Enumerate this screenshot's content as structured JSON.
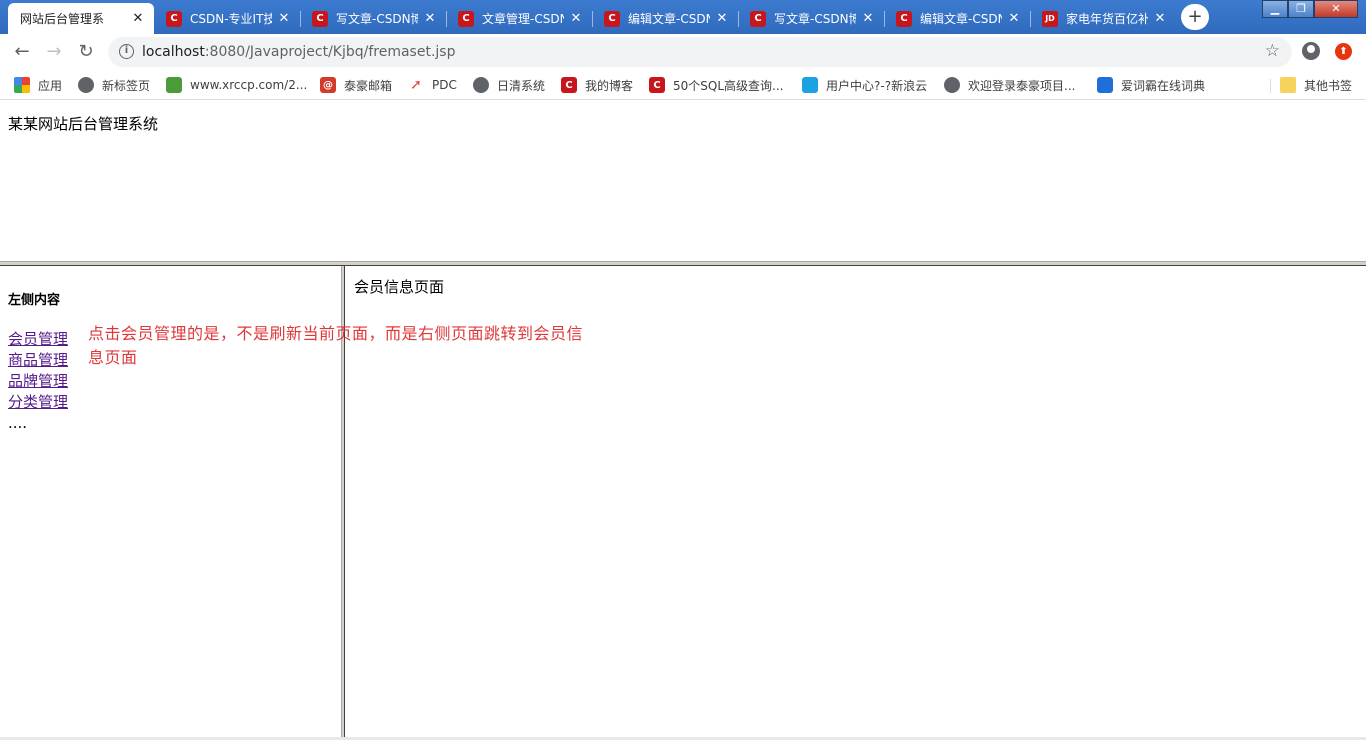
{
  "tabs": [
    {
      "title": "网站后台管理系",
      "icon": "page-icon",
      "active": true
    },
    {
      "title": "CSDN-专业IT技",
      "icon": "csdn-icon",
      "active": false
    },
    {
      "title": "写文章-CSDN博",
      "icon": "csdn-icon",
      "active": false
    },
    {
      "title": "文章管理-CSDN",
      "icon": "csdn-icon",
      "active": false
    },
    {
      "title": "编辑文章-CSDN",
      "icon": "csdn-icon",
      "active": false
    },
    {
      "title": "写文章-CSDN博",
      "icon": "csdn-icon",
      "active": false
    },
    {
      "title": "编辑文章-CSDN",
      "icon": "csdn-icon",
      "active": false
    },
    {
      "title": "家电年货百亿补",
      "icon": "jd-icon",
      "active": false
    }
  ],
  "tab_close_glyph": "✕",
  "new_tab_glyph": "+",
  "address": {
    "host": "localhost",
    "path": ":8080/Javaproject/Kjbq/fremaset.jsp"
  },
  "bookmarks": [
    {
      "label": "应用",
      "icon": "apps-icon"
    },
    {
      "label": "新标签页",
      "icon": "globe-icon"
    },
    {
      "label": "www.xrccp.com/2...",
      "icon": "xrccp-icon"
    },
    {
      "label": "泰豪邮箱",
      "icon": "mail-icon"
    },
    {
      "label": "PDC",
      "icon": "rocket-icon"
    },
    {
      "label": "日清系统",
      "icon": "globe-icon"
    },
    {
      "label": "我的博客",
      "icon": "csdn-icon"
    },
    {
      "label": "50个SQL高级查询...",
      "icon": "csdn-icon"
    },
    {
      "label": "用户中心?-?新浪云",
      "icon": "cloud-icon"
    },
    {
      "label": "欢迎登录泰豪项目...",
      "icon": "globe-icon"
    },
    {
      "label": "爱词霸在线词典",
      "icon": "user-icon"
    }
  ],
  "other_bookmarks": "其他书签",
  "page": {
    "site_title": "某某网站后台管理系统",
    "left_heading": "左侧内容",
    "nav_links": [
      "会员管理",
      "商品管理",
      "品牌管理",
      "分类管理"
    ],
    "ellipsis": "....",
    "right_text": "会员信息页面",
    "annotation": "点击会员管理的是，不是刷新当前页面，而是右侧页面跳转到会员信息页面"
  },
  "colors": {
    "tabstrip": "#3d7bd0",
    "annotation": "#e0383a",
    "visited_link": "#551a8b"
  }
}
